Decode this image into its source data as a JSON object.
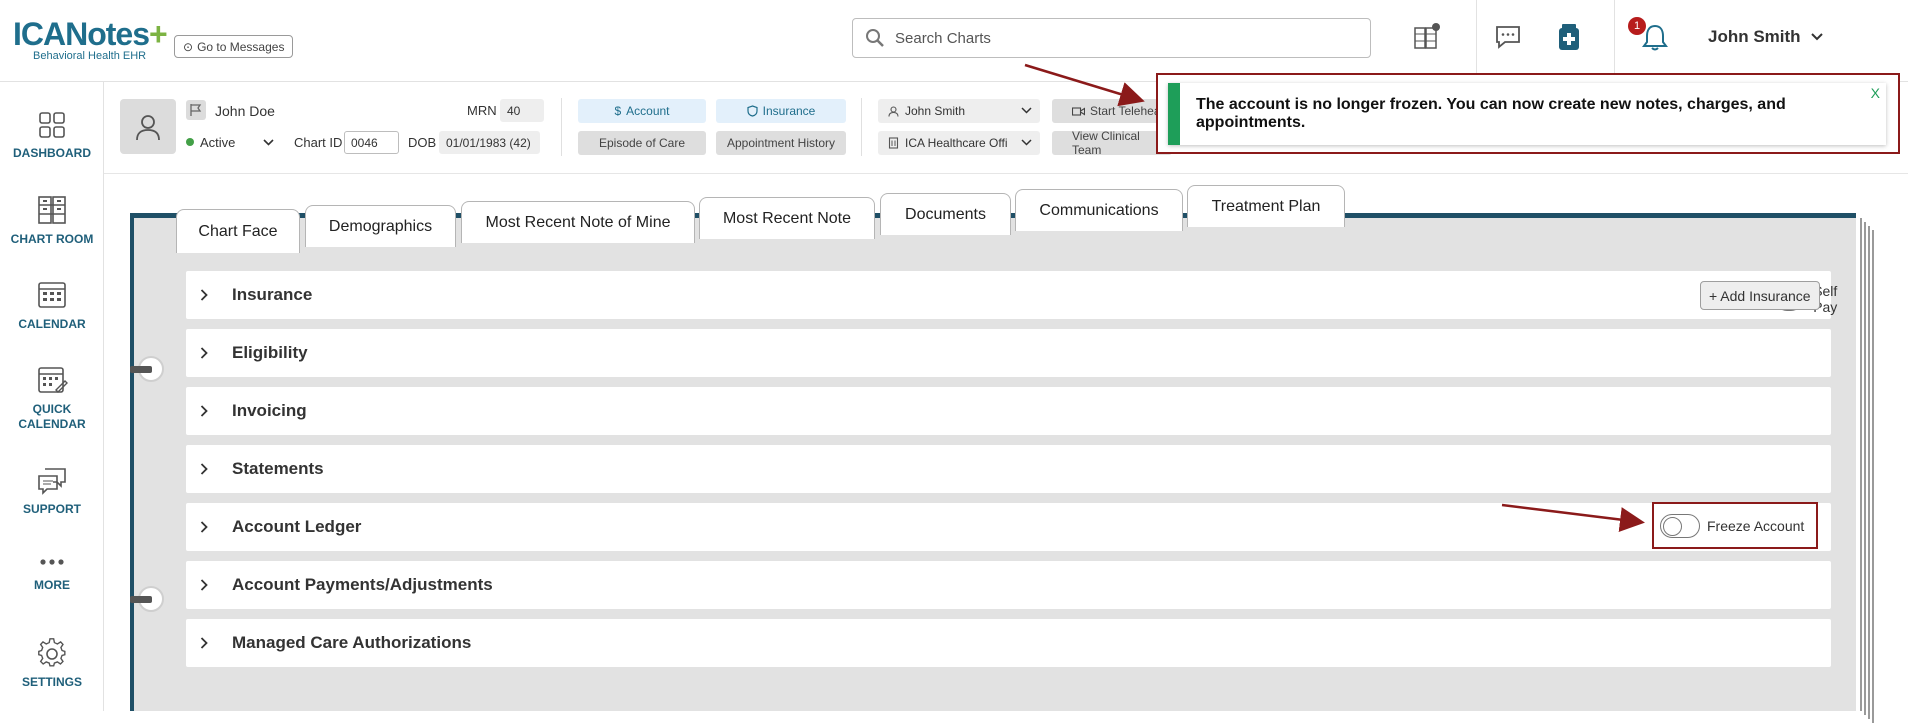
{
  "topbar": {
    "logo_main": "ICANotes",
    "logo_sub": "Behavioral Health EHR",
    "goto_messages": "Go to Messages",
    "search_placeholder": "Search Charts",
    "notification_count": "1",
    "user_name": "John Smith"
  },
  "sidebar": {
    "items": [
      {
        "label": "DASHBOARD",
        "icon": "dashboard-icon"
      },
      {
        "label": "CHART ROOM",
        "icon": "chart-room-icon"
      },
      {
        "label": "CALENDAR",
        "icon": "calendar-icon"
      },
      {
        "label": "QUICK CALENDAR",
        "icon": "quick-calendar-icon"
      },
      {
        "label": "SUPPORT",
        "icon": "support-icon"
      },
      {
        "label": "MORE",
        "icon": "more-icon"
      },
      {
        "label": "SETTINGS",
        "icon": "gear-icon"
      }
    ]
  },
  "patient": {
    "name": "John Doe",
    "status": "Active",
    "mrn_label": "MRN",
    "mrn": "40",
    "chart_id_label": "Chart ID",
    "chart_id": "0046",
    "dob_label": "DOB",
    "dob": "01/01/1983 (42)",
    "buttons": {
      "account": "Account",
      "insurance": "Insurance",
      "episode_of_care": "Episode of Care",
      "appointment_history": "Appointment History",
      "provider": "John Smith",
      "location": "ICA Healthcare Offi",
      "start_telehealth": "Start Telehealt",
      "view_clinical_team": "View Clinical Team"
    }
  },
  "toast": {
    "message": "The account is no longer frozen. You can now create new notes, charges, and appointments.",
    "close": "X",
    "accent": "#1e9e59"
  },
  "tabs": [
    "Chart Face",
    "Demographics",
    "Most Recent Note of Mine",
    "Most Recent Note",
    "Documents",
    "Communications",
    "Treatment Plan"
  ],
  "active_tab": "Chart Face",
  "sections": [
    {
      "title": "Insurance"
    },
    {
      "title": "Eligibility"
    },
    {
      "title": "Invoicing"
    },
    {
      "title": "Statements"
    },
    {
      "title": "Account Ledger"
    },
    {
      "title": "Account Payments/Adjustments"
    },
    {
      "title": "Managed Care Authorizations"
    }
  ],
  "insurance_controls": {
    "self_pay": "Self Pay",
    "add_insurance": "+ Add Insurance"
  },
  "ledger_controls": {
    "freeze_account": "Freeze Account"
  },
  "colors": {
    "brand": "#1f6e8c",
    "binder": "#1f4f66",
    "highlight": "#8b1a1a"
  }
}
